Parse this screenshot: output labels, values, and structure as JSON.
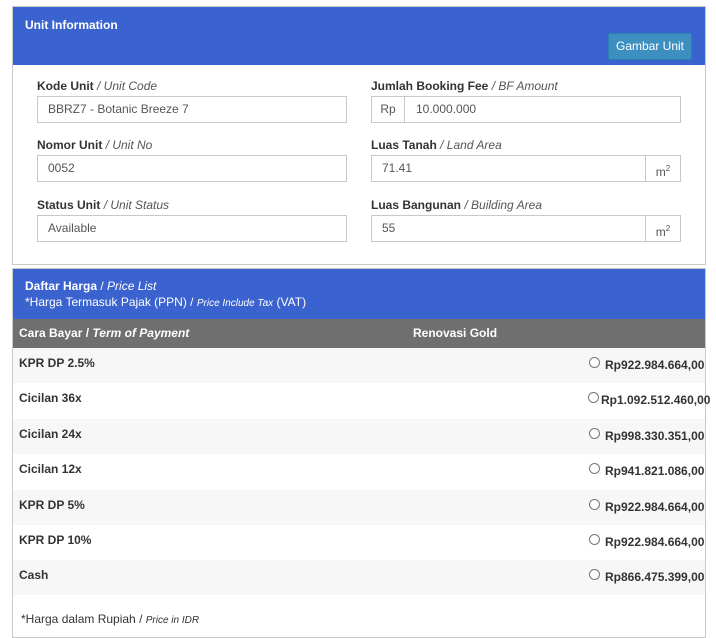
{
  "unit_panel": {
    "title": "Unit Information",
    "gambar_button": "Gambar Unit",
    "kode": {
      "label": "Kode Unit",
      "label_en": "/ Unit Code",
      "value": "BBRZ7 - Botanic Breeze 7"
    },
    "nomor": {
      "label": "Nomor Unit",
      "label_en": "/ Unit No",
      "value": "0052"
    },
    "status": {
      "label": "Status Unit",
      "label_en": "/ Unit Status",
      "value": "Available"
    },
    "booking": {
      "label": "Jumlah Booking Fee",
      "label_en": "/ BF Amount",
      "prefix": "Rp",
      "value": "10.000.000"
    },
    "tanah": {
      "label": "Luas Tanah",
      "label_en": "/ Land Area",
      "value": "71.41",
      "unit": "m",
      "unit_sup": "2"
    },
    "bangunan": {
      "label": "Luas Bangunan",
      "label_en": "/ Building Area",
      "value": "55",
      "unit": "m",
      "unit_sup": "2"
    }
  },
  "price_panel": {
    "title": "Daftar Harga",
    "title_sep": " / ",
    "title_en": "Price List",
    "tax_note": "*Harga Termasuk Pajak (PPN)  / ",
    "tax_note_en": "Price Include Tax",
    "tax_note_vat": " (VAT)",
    "col_payment": "Cara Bayar /",
    "col_payment_en": " Term of Payment",
    "col_type": "Renovasi Gold",
    "rows": [
      {
        "label": "KPR DP 2.5%",
        "price": "Rp922.984.664,00"
      },
      {
        "label": "Cicilan 36x",
        "price": "Rp1.092.512.460,00"
      },
      {
        "label": "Cicilan 24x",
        "price": "Rp998.330.351,00"
      },
      {
        "label": "Cicilan 12x",
        "price": "Rp941.821.086,00"
      },
      {
        "label": "KPR DP 5%",
        "price": "Rp922.984.664,00"
      },
      {
        "label": "KPR DP 10%",
        "price": "Rp922.984.664,00"
      },
      {
        "label": "Cash",
        "price": "Rp866.475.399,00"
      }
    ],
    "footnote": "*Harga dalam Rupiah / ",
    "footnote_en": "Price in IDR"
  }
}
